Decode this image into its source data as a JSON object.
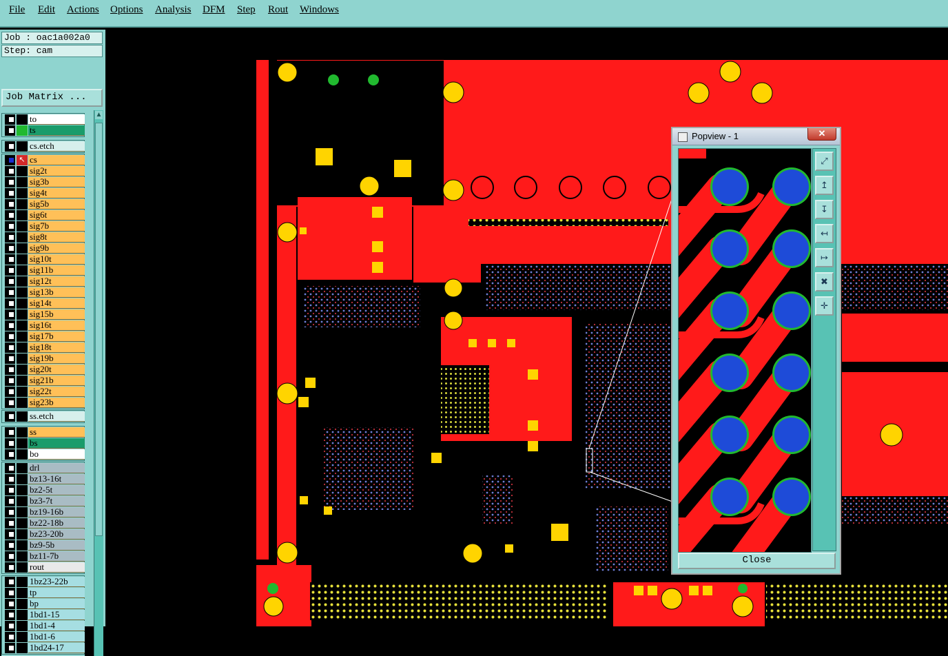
{
  "menu": [
    "File",
    "Edit",
    "Actions",
    "Options",
    "Analysis",
    "DFM",
    "Step",
    "Rout",
    "Windows"
  ],
  "job": {
    "job_line": "Job : oac1a002a0",
    "step_line": "Step: cam",
    "matrix_button": "Job Matrix ..."
  },
  "layer_groups": [
    {
      "layers": [
        {
          "name": "to",
          "color": "#ffffff",
          "mark": "none"
        },
        {
          "name": "ts",
          "color": "#1a9c6b",
          "mark": "green"
        }
      ]
    },
    {
      "layers": [
        {
          "name": "cs.etch",
          "color": "#d6efec",
          "mark": "none"
        }
      ]
    },
    {
      "layers": [
        {
          "name": "cs",
          "color": "#ffc058",
          "mark": "active"
        },
        {
          "name": "sig2t",
          "color": "#ffc058",
          "mark": "none"
        },
        {
          "name": "sig3b",
          "color": "#ffc058",
          "mark": "none"
        },
        {
          "name": "sig4t",
          "color": "#ffc058",
          "mark": "none"
        },
        {
          "name": "sig5b",
          "color": "#ffc058",
          "mark": "none"
        },
        {
          "name": "sig6t",
          "color": "#ffc058",
          "mark": "none"
        },
        {
          "name": "sig7b",
          "color": "#ffc058",
          "mark": "none"
        },
        {
          "name": "sig8t",
          "color": "#ffc058",
          "mark": "none"
        },
        {
          "name": "sig9b",
          "color": "#ffc058",
          "mark": "none"
        },
        {
          "name": "sig10t",
          "color": "#ffc058",
          "mark": "none"
        },
        {
          "name": "sig11b",
          "color": "#ffc058",
          "mark": "none"
        },
        {
          "name": "sig12t",
          "color": "#ffc058",
          "mark": "none"
        },
        {
          "name": "sig13b",
          "color": "#ffc058",
          "mark": "none"
        },
        {
          "name": "sig14t",
          "color": "#ffc058",
          "mark": "none"
        },
        {
          "name": "sig15b",
          "color": "#ffc058",
          "mark": "none"
        },
        {
          "name": "sig16t",
          "color": "#ffc058",
          "mark": "none"
        },
        {
          "name": "sig17b",
          "color": "#ffc058",
          "mark": "none"
        },
        {
          "name": "sig18t",
          "color": "#ffc058",
          "mark": "none"
        },
        {
          "name": "sig19b",
          "color": "#ffc058",
          "mark": "none"
        },
        {
          "name": "sig20t",
          "color": "#ffc058",
          "mark": "none"
        },
        {
          "name": "sig21b",
          "color": "#ffc058",
          "mark": "none"
        },
        {
          "name": "sig22t",
          "color": "#ffc058",
          "mark": "none"
        },
        {
          "name": "sig23b",
          "color": "#ffc058",
          "mark": "none"
        }
      ]
    },
    {
      "layers": [
        {
          "name": "ss.etch",
          "color": "#d6efec",
          "mark": "none"
        }
      ]
    },
    {
      "layers": [
        {
          "name": "ss",
          "color": "#ffc058",
          "mark": "none"
        },
        {
          "name": "bs",
          "color": "#1a9c6b",
          "mark": "none"
        },
        {
          "name": "bo",
          "color": "#ffffff",
          "mark": "none"
        }
      ]
    },
    {
      "layers": [
        {
          "name": "drl",
          "color": "#a9bcc4",
          "mark": "none"
        },
        {
          "name": "bz13-16t",
          "color": "#a9bcc4",
          "mark": "none"
        },
        {
          "name": "bz2-5t",
          "color": "#a9bcc4",
          "mark": "none"
        },
        {
          "name": "bz3-7t",
          "color": "#a9bcc4",
          "mark": "none"
        },
        {
          "name": "bz19-16b",
          "color": "#a9bcc4",
          "mark": "none"
        },
        {
          "name": "bz22-18b",
          "color": "#a9bcc4",
          "mark": "none"
        },
        {
          "name": "bz23-20b",
          "color": "#a9bcc4",
          "mark": "none"
        },
        {
          "name": "bz9-5b",
          "color": "#a9bcc4",
          "mark": "none"
        },
        {
          "name": "bz11-7b",
          "color": "#a9bcc4",
          "mark": "none"
        },
        {
          "name": "rout",
          "color": "#e9e9e9",
          "mark": "none"
        }
      ]
    },
    {
      "layers": [
        {
          "name": "1bz23-22b",
          "color": "#a6dee2",
          "mark": "none"
        },
        {
          "name": "tp",
          "color": "#a6dee2",
          "mark": "none"
        },
        {
          "name": "bp",
          "color": "#a6dee2",
          "mark": "none"
        },
        {
          "name": "1bd1-15",
          "color": "#a6dee2",
          "mark": "none"
        },
        {
          "name": "1bd1-4",
          "color": "#a6dee2",
          "mark": "none"
        },
        {
          "name": "1bd1-6",
          "color": "#a6dee2",
          "mark": "none"
        },
        {
          "name": "1bd24-17",
          "color": "#a6dee2",
          "mark": "none"
        }
      ]
    }
  ],
  "popview": {
    "title": "Popview - 1",
    "close_x": "✕",
    "close_button": "Close",
    "tools": [
      "zoom-fit-icon",
      "pan-up-icon",
      "pan-down-icon",
      "pan-left-icon",
      "pan-right-icon",
      "zoom-in-icon",
      "zoom-out-icon"
    ]
  },
  "colors": {
    "copper": "#ff1a1a",
    "pad": "#ffd400",
    "via_fill": "#1e4bd8",
    "via_ring": "#21b92f",
    "ui_teal": "#8fd4cf"
  }
}
